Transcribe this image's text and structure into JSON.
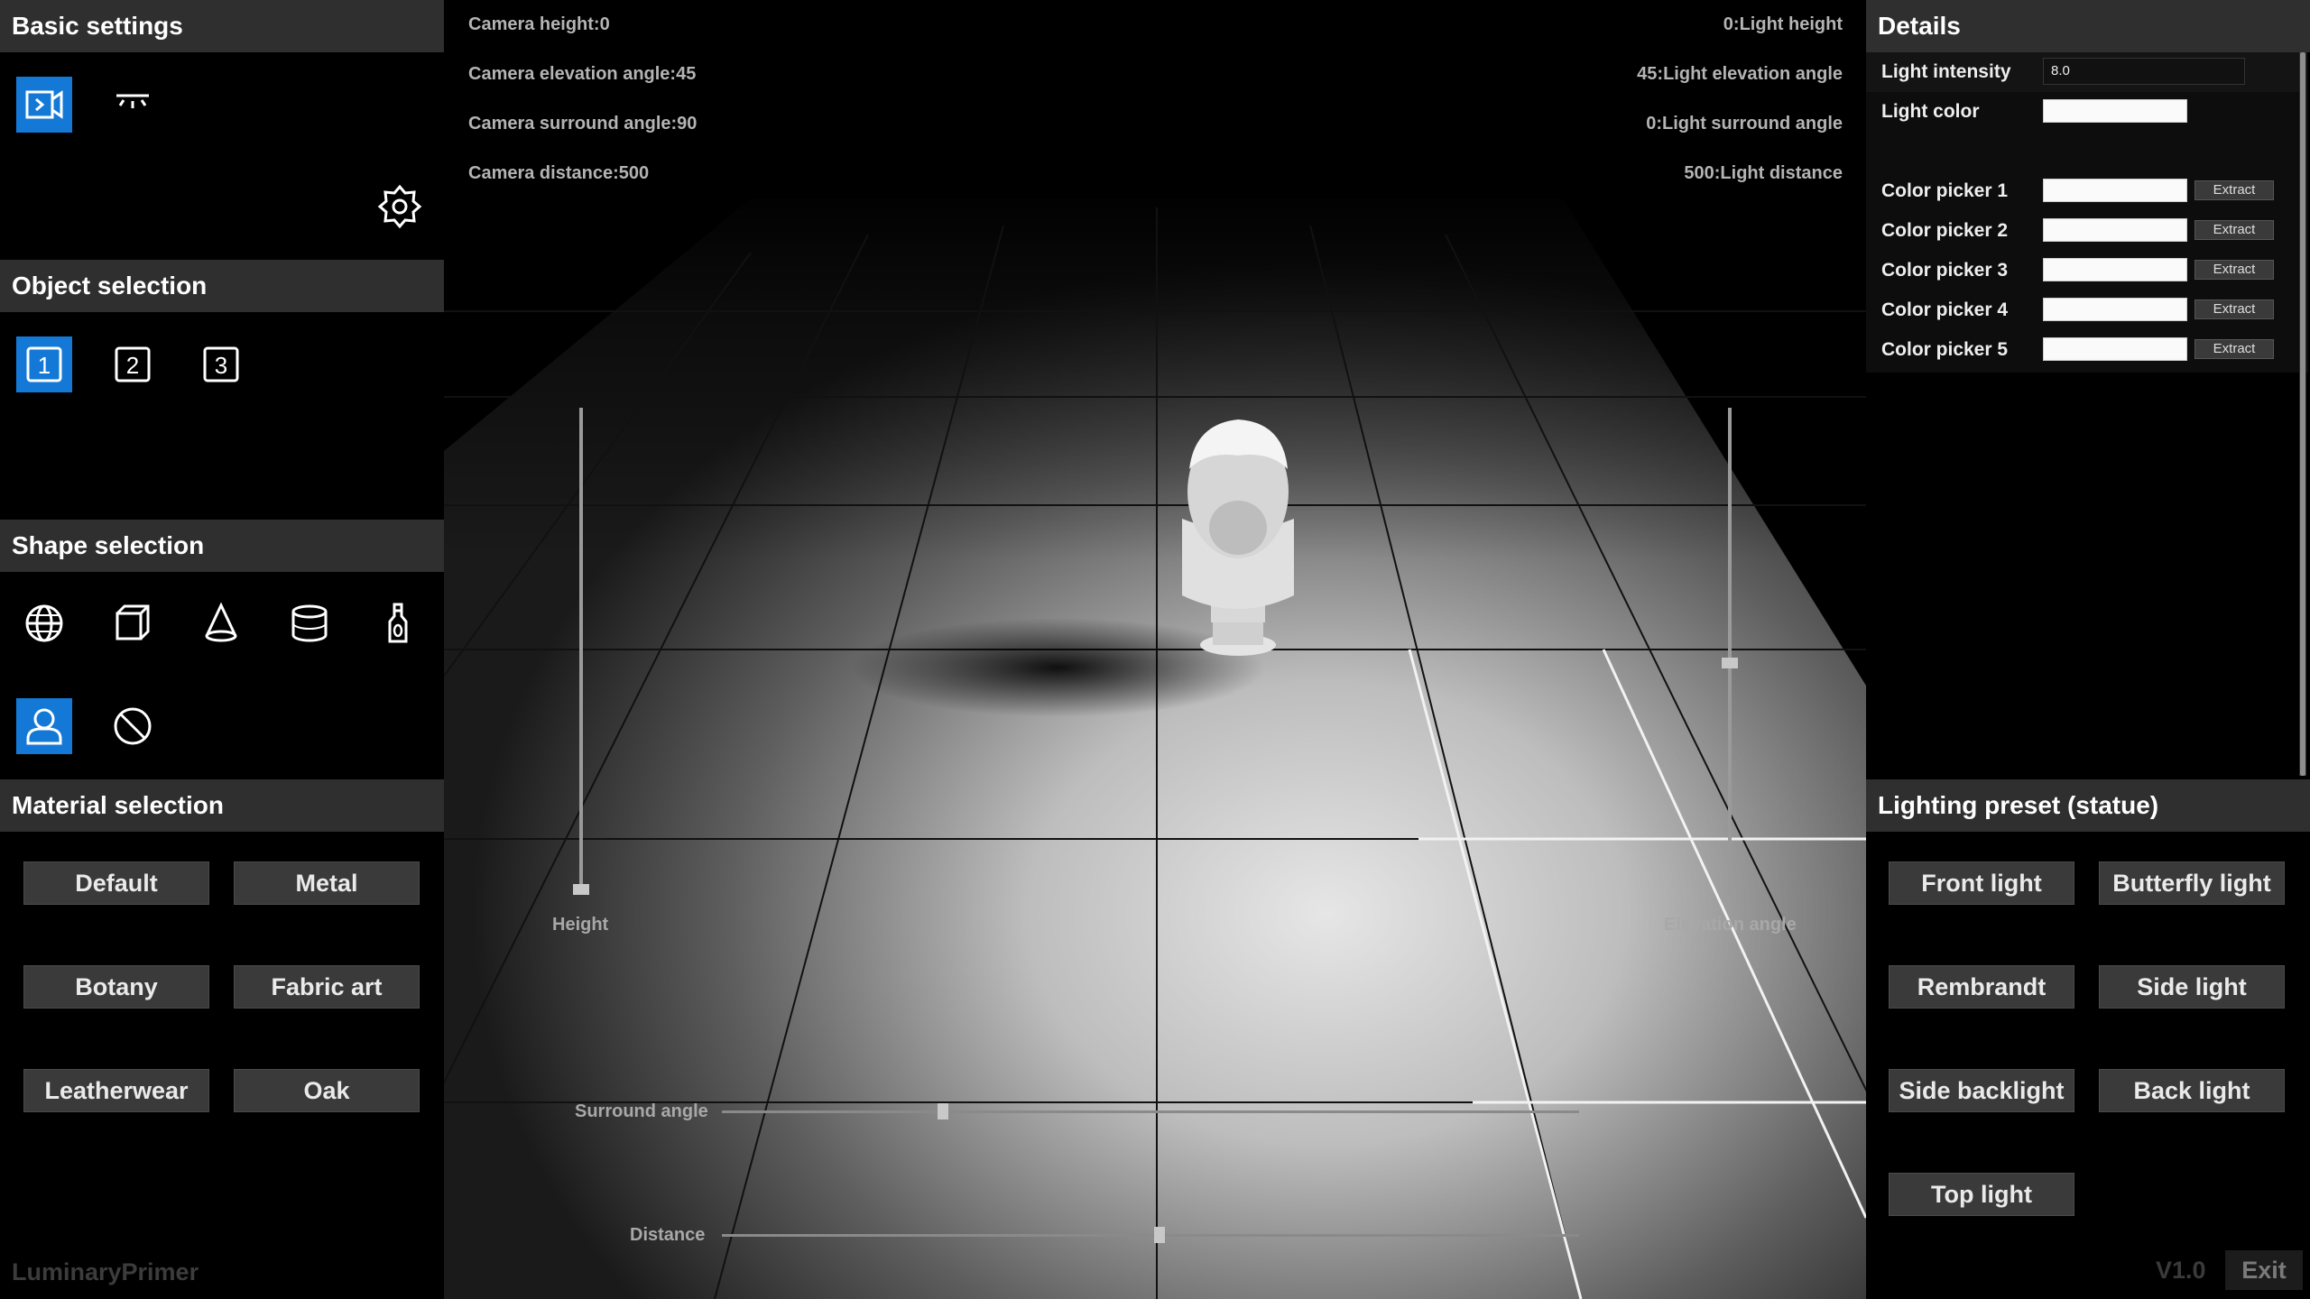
{
  "left": {
    "basic_settings": {
      "title": "Basic settings",
      "camera_mode_icon": "camera-mode-icon",
      "light_mode_icon": "light-mode-icon",
      "settings_icon": "gear-icon"
    },
    "object_selection": {
      "title": "Object selection",
      "items": [
        "1",
        "2",
        "3"
      ],
      "selected": "1"
    },
    "shape_selection": {
      "title": "Shape selection",
      "shapes": [
        "sphere-icon",
        "cube-icon",
        "cone-icon",
        "cylinder-icon",
        "bottle-icon",
        "bust-icon",
        "none-icon"
      ],
      "selected": "bust-icon"
    },
    "material_selection": {
      "title": "Material selection",
      "materials": [
        "Default",
        "Metal",
        "Botany",
        "Fabric art",
        "Leatherwear",
        "Oak"
      ]
    },
    "brand": "LuminaryPrimer"
  },
  "viewport": {
    "camera_height": "Camera height:0",
    "camera_elevation": "Camera elevation angle:45",
    "camera_surround": "Camera surround angle:90",
    "camera_distance": "Camera distance:500",
    "light_height": "0:Light height",
    "light_elevation": "45:Light elevation angle",
    "light_surround": "0:Light surround angle",
    "light_distance": "500:Light distance",
    "sliders": {
      "height": {
        "label": "Height",
        "value": 0
      },
      "elevation": {
        "label": "Elevation angle",
        "value": 45
      },
      "surround": {
        "label": "Surround angle",
        "value": 90
      },
      "distance": {
        "label": "Distance",
        "value": 500
      }
    }
  },
  "right": {
    "details": {
      "title": "Details",
      "light_intensity_label": "Light intensity",
      "light_intensity_value": "8.0",
      "light_color_label": "Light color",
      "pickers": [
        "Color picker 1",
        "Color picker 2",
        "Color picker 3",
        "Color picker 4",
        "Color picker 5"
      ],
      "extract_label": "Extract"
    },
    "lighting_preset": {
      "title": "Lighting preset (statue)",
      "presets": [
        "Front light",
        "Butterfly light",
        "Rembrandt",
        "Side light",
        "Side backlight",
        "Back light",
        "Top light"
      ]
    },
    "version": "V1.0",
    "exit": "Exit"
  },
  "colors": {
    "accent": "#1479d6",
    "panel_header": "#2f2f2f",
    "button": "#3a3a3a"
  }
}
